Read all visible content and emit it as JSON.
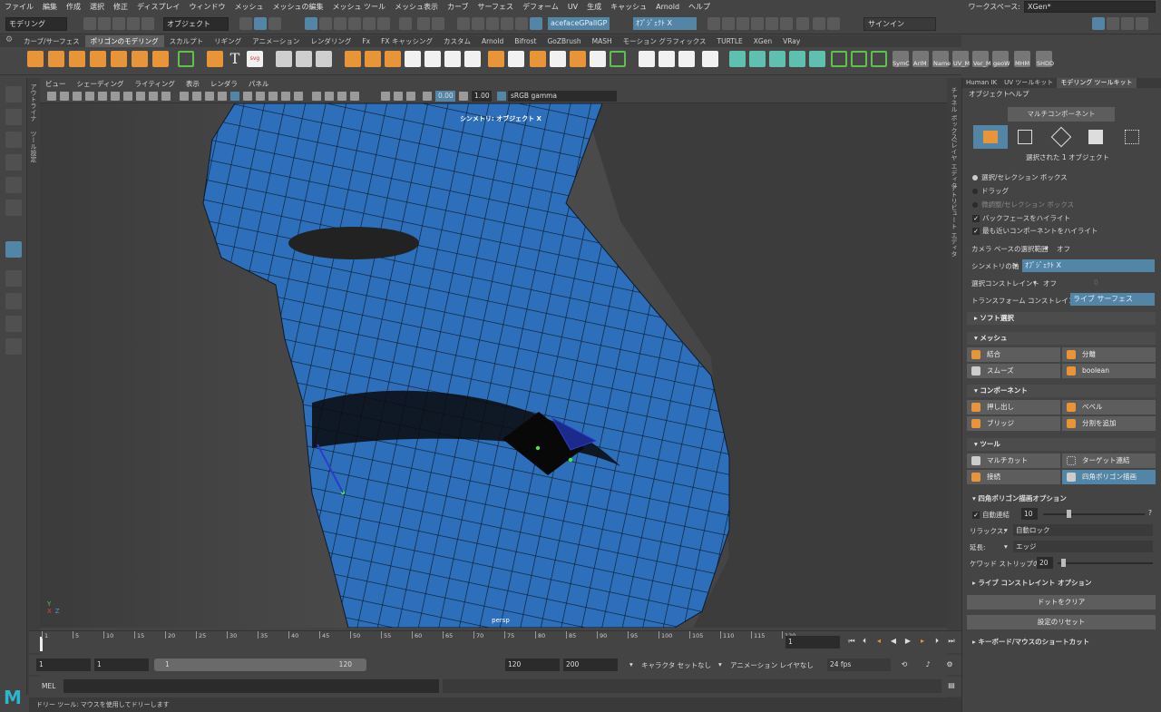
{
  "menus": [
    "ファイル",
    "編集",
    "作成",
    "選択",
    "修正",
    "ディスプレイ",
    "ウィンドウ",
    "メッシュ",
    "メッシュの編集",
    "メッシュ ツール",
    "メッシュ表示",
    "カーブ",
    "サーフェス",
    "デフォーム",
    "UV",
    "生成",
    "キャッシュ",
    "Arnold",
    "ヘルプ"
  ],
  "workspace": {
    "label": "ワークスペース:",
    "value": "XGen*"
  },
  "status": {
    "mode": "モデリング",
    "object_dropdown": "オブジェクト",
    "symmetry_field": "acefaceGPallGP",
    "object_field": "ｵﾌﾞｼﾞｪｸﾄ X",
    "signin": "サインイン"
  },
  "shelf": {
    "tabs": [
      "カーブ/サーフェス",
      "ポリゴンのモデリング",
      "スカルプト",
      "リギング",
      "アニメーション",
      "レンダリング",
      "Fx",
      "FX キャッシング",
      "カスタム",
      "Arnold",
      "Bifrost",
      "GoZBrush",
      "MASH",
      "モーション グラフィックス",
      "TURTLE",
      "XGen",
      "VRay"
    ],
    "active_tab": 1,
    "labels": [
      "SymC",
      "ArIM",
      "Name",
      "UV_M",
      "Ver_M",
      "geoW",
      "MHM",
      "SHDD"
    ]
  },
  "panel": {
    "menus": [
      "ビュー",
      "シェーディング",
      "ライティング",
      "表示",
      "レンダラ",
      "パネル"
    ],
    "val_a": "0.00",
    "val_b": "1.00",
    "colorspace": "sRGB gamma"
  },
  "viewport": {
    "symmetry_label": "シンメトリ: オブジェクト X",
    "camera": "persp"
  },
  "side_tabs": {
    "left_a": "アウトライナ",
    "left_b": "ツール設定",
    "right_a": "チャネル ボックス/レイヤ エディタ",
    "right_b": "アトリビュート エディタ"
  },
  "right": {
    "tabs": [
      "Human IK",
      "UV ツールキット",
      "モデリング ツールキット"
    ],
    "active_tab": 2,
    "submenu": [
      "オブジェクト",
      "ヘルプ"
    ],
    "multi_button": "マルチコンポーネント",
    "selected_text": "選択された 1 オブジェクト",
    "radios": [
      "選択/セレクション ボックス",
      "ドラッグ",
      "微調整/セレクション ボックス"
    ],
    "checks": [
      "バックフェースをハイライト",
      "最も近いコンポーネントをハイライト"
    ],
    "camera_based": {
      "label": "カメラ ベースの選択範囲",
      "value": "オフ"
    },
    "symmetry": {
      "label": "シンメトリの軸",
      "value": "ｵﾌﾞｼﾞｪｸﾄ X"
    },
    "select_constraint": {
      "label": "選択コンストレイント",
      "value": "オフ",
      "num": "0"
    },
    "transform_constraint": {
      "label": "トランスフォーム コンストレイント",
      "value": "ライブ サーフェス"
    },
    "soft_select": "ソフト選択",
    "mesh_section": "メッシュ",
    "mesh_buttons": [
      "結合",
      "分離",
      "スムーズ",
      "boolean"
    ],
    "component_section": "コンポーネント",
    "component_buttons": [
      "押し出し",
      "ベベル",
      "ブリッジ",
      "分割を追加"
    ],
    "tools_section": "ツール",
    "tools_buttons": [
      "マルチカット",
      "ターゲット連結",
      "接続",
      "四角ポリゴン描画"
    ],
    "quad_options": "四角ポリゴン描画オプション",
    "auto_weld": {
      "label": "自動連結",
      "value": "10",
      "help": "?"
    },
    "relax": {
      "label": "リラックス:",
      "value": "自動ロック"
    },
    "extend": {
      "label": "延長:",
      "value": "エッジ"
    },
    "strip_width": {
      "label": "ケワッド ストリップの幅:",
      "value": "20"
    },
    "live_constraint": "ライブ コンストレイント オプション",
    "clear_dots": "ドットをクリア",
    "reset": "設定のリセット",
    "shortcuts": "キーボード/マウスのショートカット"
  },
  "timeline": {
    "ticks": [
      "1",
      "5",
      "10",
      "15",
      "20",
      "25",
      "30",
      "35",
      "40",
      "45",
      "50",
      "55",
      "60",
      "65",
      "70",
      "75",
      "80",
      "85",
      "90",
      "95",
      "100",
      "105",
      "110",
      "115",
      "120"
    ],
    "current": "1"
  },
  "range": {
    "start": "1",
    "start2": "1",
    "slider_start": "1",
    "slider_end": "120",
    "end": "120",
    "end2": "200",
    "char_set": "キャラクタ セットなし",
    "anim_layer": "アニメーション レイヤなし",
    "fps": "24 fps"
  },
  "cmd": {
    "lang": "MEL"
  },
  "help": "ドリー ツール: マウスを使用してドリーします",
  "logo": "M"
}
